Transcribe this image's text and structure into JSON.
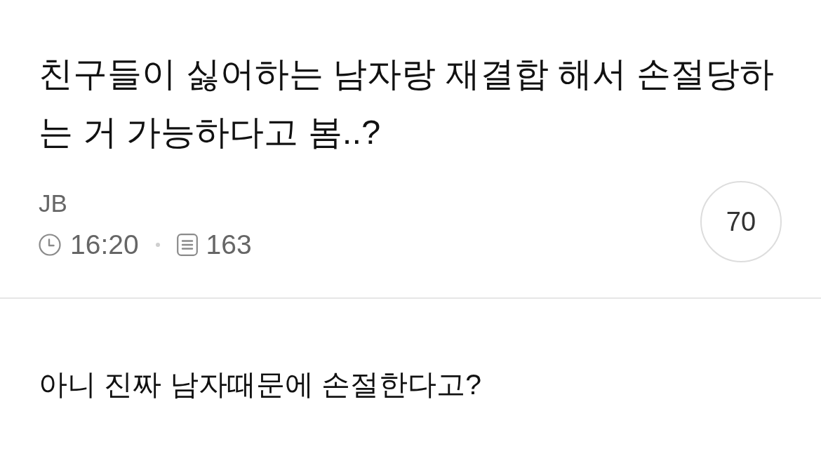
{
  "post": {
    "title": "친구들이 싫어하는 남자랑 재결합 해서 손절당하는 거 가능하다고 봄..?",
    "author": "JB",
    "time": "16:20",
    "views": "163",
    "comment_count": "70"
  },
  "body": {
    "text": "아니 진짜 남자때문에 손절한다고?"
  }
}
